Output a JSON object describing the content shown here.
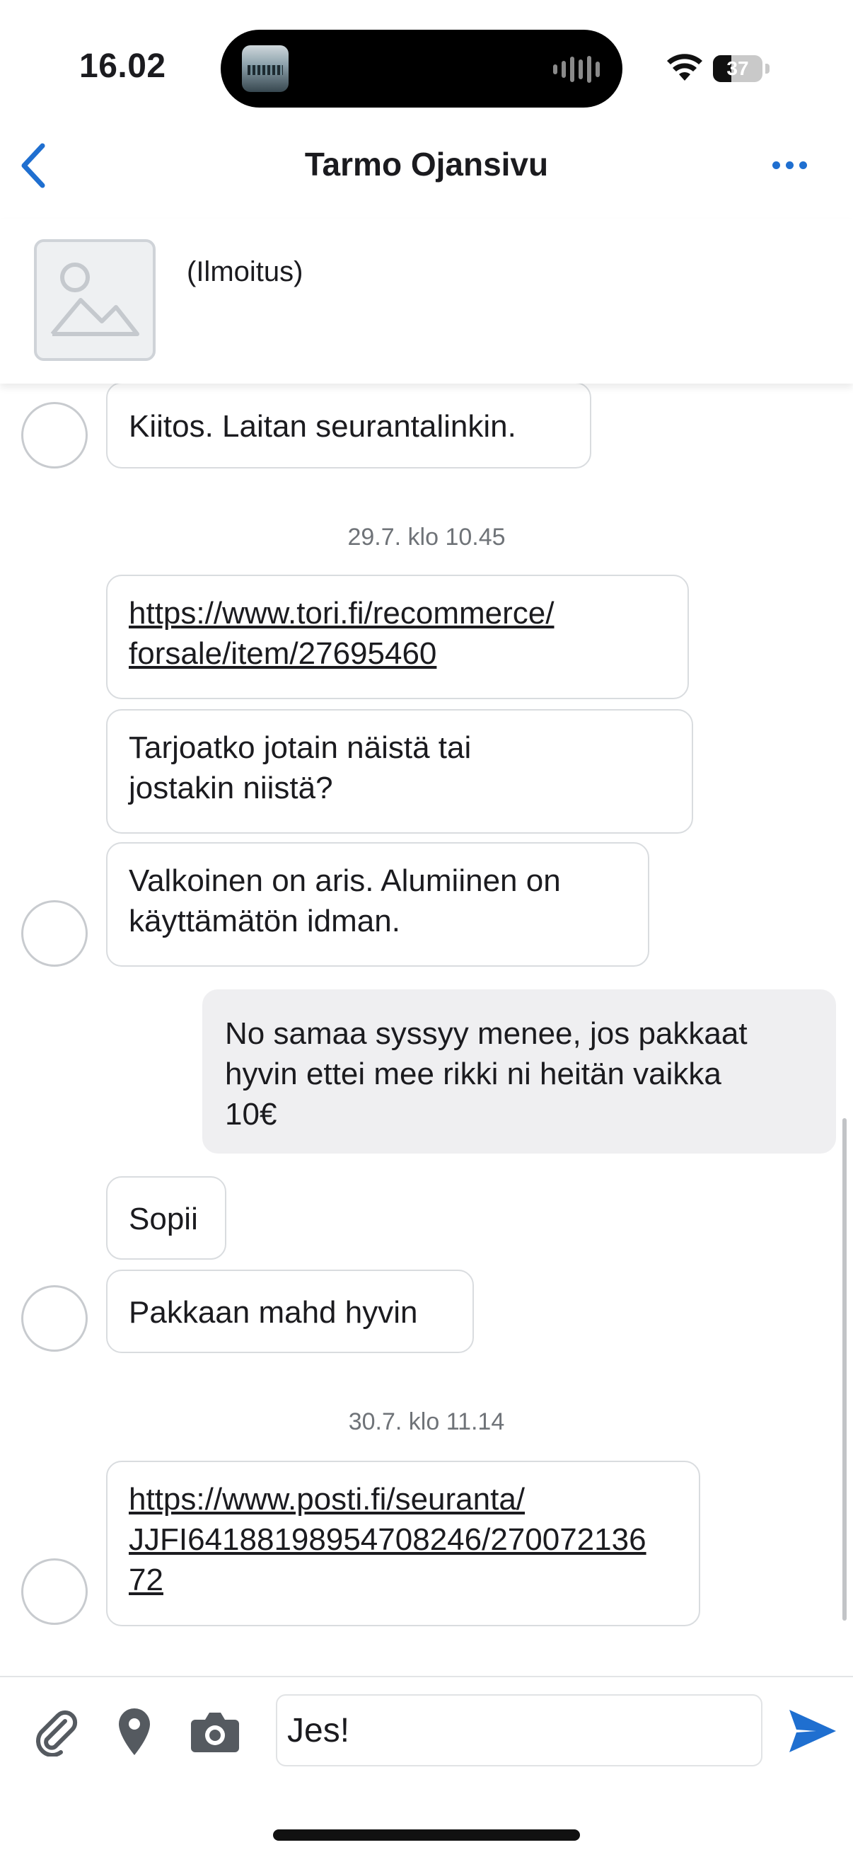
{
  "status_bar": {
    "time": "16.02",
    "battery_level": "37",
    "battery_fraction": 0.37
  },
  "nav": {
    "title": "Tarmo Ojansivu",
    "back_icon": "chevron-left-icon",
    "more_icon": "ellipsis-icon"
  },
  "listing": {
    "label": "(Ilmoitus)",
    "image_icon": "image-placeholder-icon"
  },
  "messages": [
    {
      "id": "m1",
      "side": "in",
      "text": "Kiitos. Laitan seurantalinkin.",
      "avatar": true
    },
    {
      "id": "d1",
      "type": "date",
      "text": "29.7. klo 10.45"
    },
    {
      "id": "m2",
      "side": "in",
      "link": true,
      "lines": [
        "https://www.tori.fi/recommerce/",
        "forsale/item/27695460"
      ]
    },
    {
      "id": "m3",
      "side": "in",
      "lines": [
        "Tarjoatko jotain näistä tai",
        "jostakin niistä?"
      ]
    },
    {
      "id": "m4",
      "side": "in",
      "lines": [
        "Valkoinen on aris. Alumiinen on",
        "käyttämätön idman."
      ],
      "avatar": true
    },
    {
      "id": "m5",
      "side": "out",
      "lines": [
        "No samaa syssyy menee, jos pakkaat",
        "hyvin ettei mee rikki ni heitän vaikka",
        "10€"
      ]
    },
    {
      "id": "m6",
      "side": "in",
      "text": "Sopii"
    },
    {
      "id": "m7",
      "side": "in",
      "text": "Pakkaan mahd hyvin",
      "avatar": true
    },
    {
      "id": "d2",
      "type": "date",
      "text": "30.7. klo 11.14"
    },
    {
      "id": "m8",
      "side": "in",
      "link": true,
      "lines": [
        "https://www.posti.fi/seuranta/",
        "JJFI64188198954708246/270072136",
        "72"
      ],
      "avatar": true
    }
  ],
  "composer": {
    "input_value": "Jes!",
    "attach_icon": "paperclip-icon",
    "location_icon": "location-pin-icon",
    "camera_icon": "camera-icon",
    "send_icon": "send-icon"
  },
  "colors": {
    "accent": "#1f6fd0",
    "incoming_bubble": "#ffffff",
    "outgoing_bubble": "#efeff1",
    "bubble_border": "#d9dcdf",
    "date_text": "#6f7378"
  }
}
